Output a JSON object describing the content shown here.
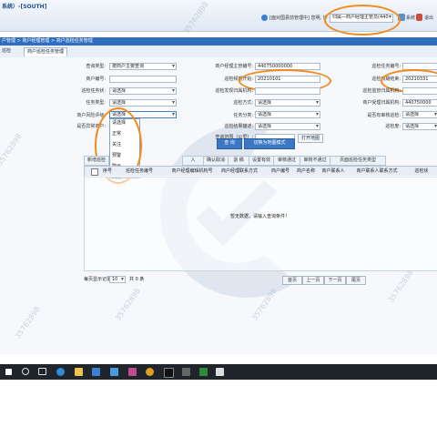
{
  "app": {
    "title": "系统）-[SOUTH]",
    "user_info": "[面对国县前管理中] 您明, 许 子为 ",
    "role_select": "归属—商户经理主管员(440",
    "links": [
      "系统",
      "退出"
    ]
  },
  "breadcrumb": "户管理 > 商户经理管理 > 商户巡检任务管理",
  "tabs": [
    "巡检",
    "商户巡检任务管理"
  ],
  "form": {
    "fields": [
      {
        "label": "查询类型:",
        "value": "按商户主要查询",
        "kind": "select"
      },
      {
        "label": "商户编号:",
        "value": "",
        "kind": "input"
      },
      {
        "label": "巡检任务状:",
        "value": "请选择",
        "kind": "select"
      },
      {
        "label": "任务类型:",
        "value": "请选择",
        "kind": "select"
      },
      {
        "label": "商户风险评级:",
        "value": "请选择",
        "kind": "select"
      },
      {
        "label": "是否异常商户:",
        "value": "",
        "kind": "input"
      },
      {
        "label": "商户经理主管编号:",
        "value": "440750000000",
        "kind": "input"
      },
      {
        "label": "巡检频期开始:",
        "value": "20210101",
        "kind": "input"
      },
      {
        "label": "巡检发现归属机构:",
        "value": "",
        "kind": "input"
      },
      {
        "label": "巡检方式:",
        "value": "请选择",
        "kind": "select"
      },
      {
        "label": "任务分类:",
        "value": "请选择",
        "kind": "select"
      },
      {
        "label": "巡检结果描述:",
        "value": "请选择",
        "kind": "select"
      },
      {
        "label": "查询范围（公里）:",
        "value": "",
        "kind": "input"
      },
      {
        "label": "巡检任务编号:",
        "value": "",
        "kind": "input"
      },
      {
        "label": "巡检频期结束:",
        "value": "20210331",
        "kind": "input"
      },
      {
        "label": "巡检监管归属机构:",
        "value": "",
        "kind": "input"
      },
      {
        "label": "商户受理归属机构:",
        "value": "440750000",
        "kind": "input"
      },
      {
        "label": "是否有审核巡检:",
        "value": "请选择",
        "kind": "select"
      },
      {
        "label": "巡检度:",
        "value": "请选择",
        "kind": "select"
      }
    ],
    "map_button": "打开地图",
    "dropdown_options": [
      "请选择",
      "正常",
      "关注",
      "预警",
      "警示",
      "风险"
    ]
  },
  "actions": {
    "query": "查 询",
    "switch_map": "切换为地图模式"
  },
  "grid": {
    "tabs": [
      "新增巡检",
      "入",
      "确认取消",
      "退 稿",
      "设置有效",
      "审核通过",
      "审核不通过",
      "页面巡检任务类型"
    ],
    "columns": [
      "序号",
      "巡检任务编号",
      "商户经理编辑机构号",
      "商户经理联系方式",
      "商户编号",
      "商户名称",
      "商户联系人",
      "商户联系人联系方式",
      "巡检状"
    ],
    "empty_text": "暂无数据，请输入查询条件！"
  },
  "pager": {
    "page_size_label": "每页显示记录",
    "page_size": "10",
    "count_text": "共 0 条",
    "buttons": [
      "首页",
      "上一页",
      "下一页",
      "尾页"
    ]
  },
  "watermark": "35762898",
  "colors": {
    "accent": "#2f6ebd",
    "annotation": "#f28a1c",
    "taskbar": "#20242b"
  },
  "taskbar_icons": [
    "windows-icon",
    "search-icon",
    "taskview-icon",
    "edge-icon",
    "folder-icon",
    "store-icon",
    "mail-icon",
    "app-icon",
    "chrome-icon",
    "terminal-icon",
    "media-icon",
    "excel-icon",
    "window-icon"
  ]
}
